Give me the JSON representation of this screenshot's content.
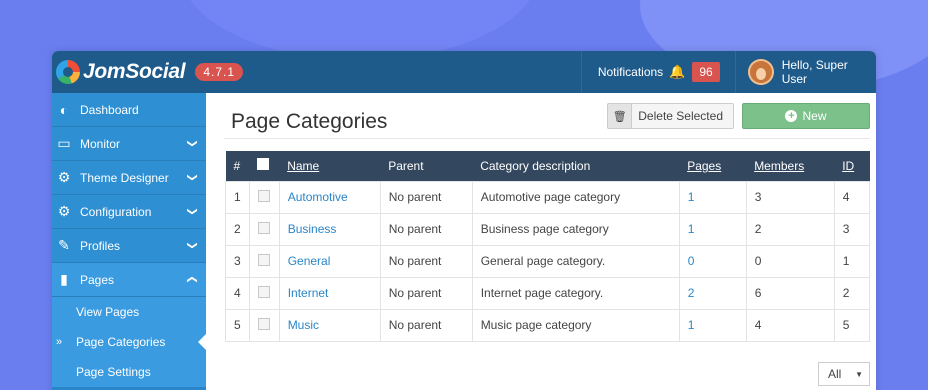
{
  "app": {
    "brand": "JomSocial",
    "version": "4.7.1",
    "notifications_label": "Notifications",
    "notifications_count": "96",
    "user_greeting": "Hello, Super User"
  },
  "sidebar": {
    "items": [
      {
        "label": "Dashboard",
        "icon": "dashboard-icon"
      },
      {
        "label": "Monitor",
        "icon": "monitor-icon"
      },
      {
        "label": "Theme Designer",
        "icon": "gears-icon"
      },
      {
        "label": "Configuration",
        "icon": "gears-icon"
      },
      {
        "label": "Profiles",
        "icon": "edit-icon"
      },
      {
        "label": "Pages",
        "icon": "book-icon"
      }
    ],
    "subitems": [
      {
        "label": "View Pages"
      },
      {
        "label": "Page Categories"
      },
      {
        "label": "Page Settings"
      }
    ]
  },
  "main": {
    "title": "Page Categories",
    "delete_label": "Delete Selected",
    "new_label": "New",
    "pager_value": "All"
  },
  "table": {
    "headers": [
      "#",
      "Name",
      "Parent",
      "Category description",
      "Pages",
      "Members",
      "ID"
    ],
    "rows": [
      {
        "num": "1",
        "name": "Automotive",
        "parent": "No parent",
        "desc": "Automotive page category",
        "pages": "1",
        "members": "3",
        "id": "4"
      },
      {
        "num": "2",
        "name": "Business",
        "parent": "No parent",
        "desc": "Business page category",
        "pages": "1",
        "members": "2",
        "id": "3"
      },
      {
        "num": "3",
        "name": "General",
        "parent": "No parent",
        "desc": "General page category.",
        "pages": "0",
        "members": "0",
        "id": "1"
      },
      {
        "num": "4",
        "name": "Internet",
        "parent": "No parent",
        "desc": "Internet page category.",
        "pages": "2",
        "members": "6",
        "id": "2"
      },
      {
        "num": "5",
        "name": "Music",
        "parent": "No parent",
        "desc": "Music page category",
        "pages": "1",
        "members": "4",
        "id": "5"
      }
    ]
  },
  "colors": {
    "topbar": "#1e5a8a",
    "sidebar": "#2f8fd3",
    "accent_link": "#2a86c8",
    "badge_red": "#d9534f",
    "new_button": "#7cc08a",
    "table_header": "#33485e"
  }
}
